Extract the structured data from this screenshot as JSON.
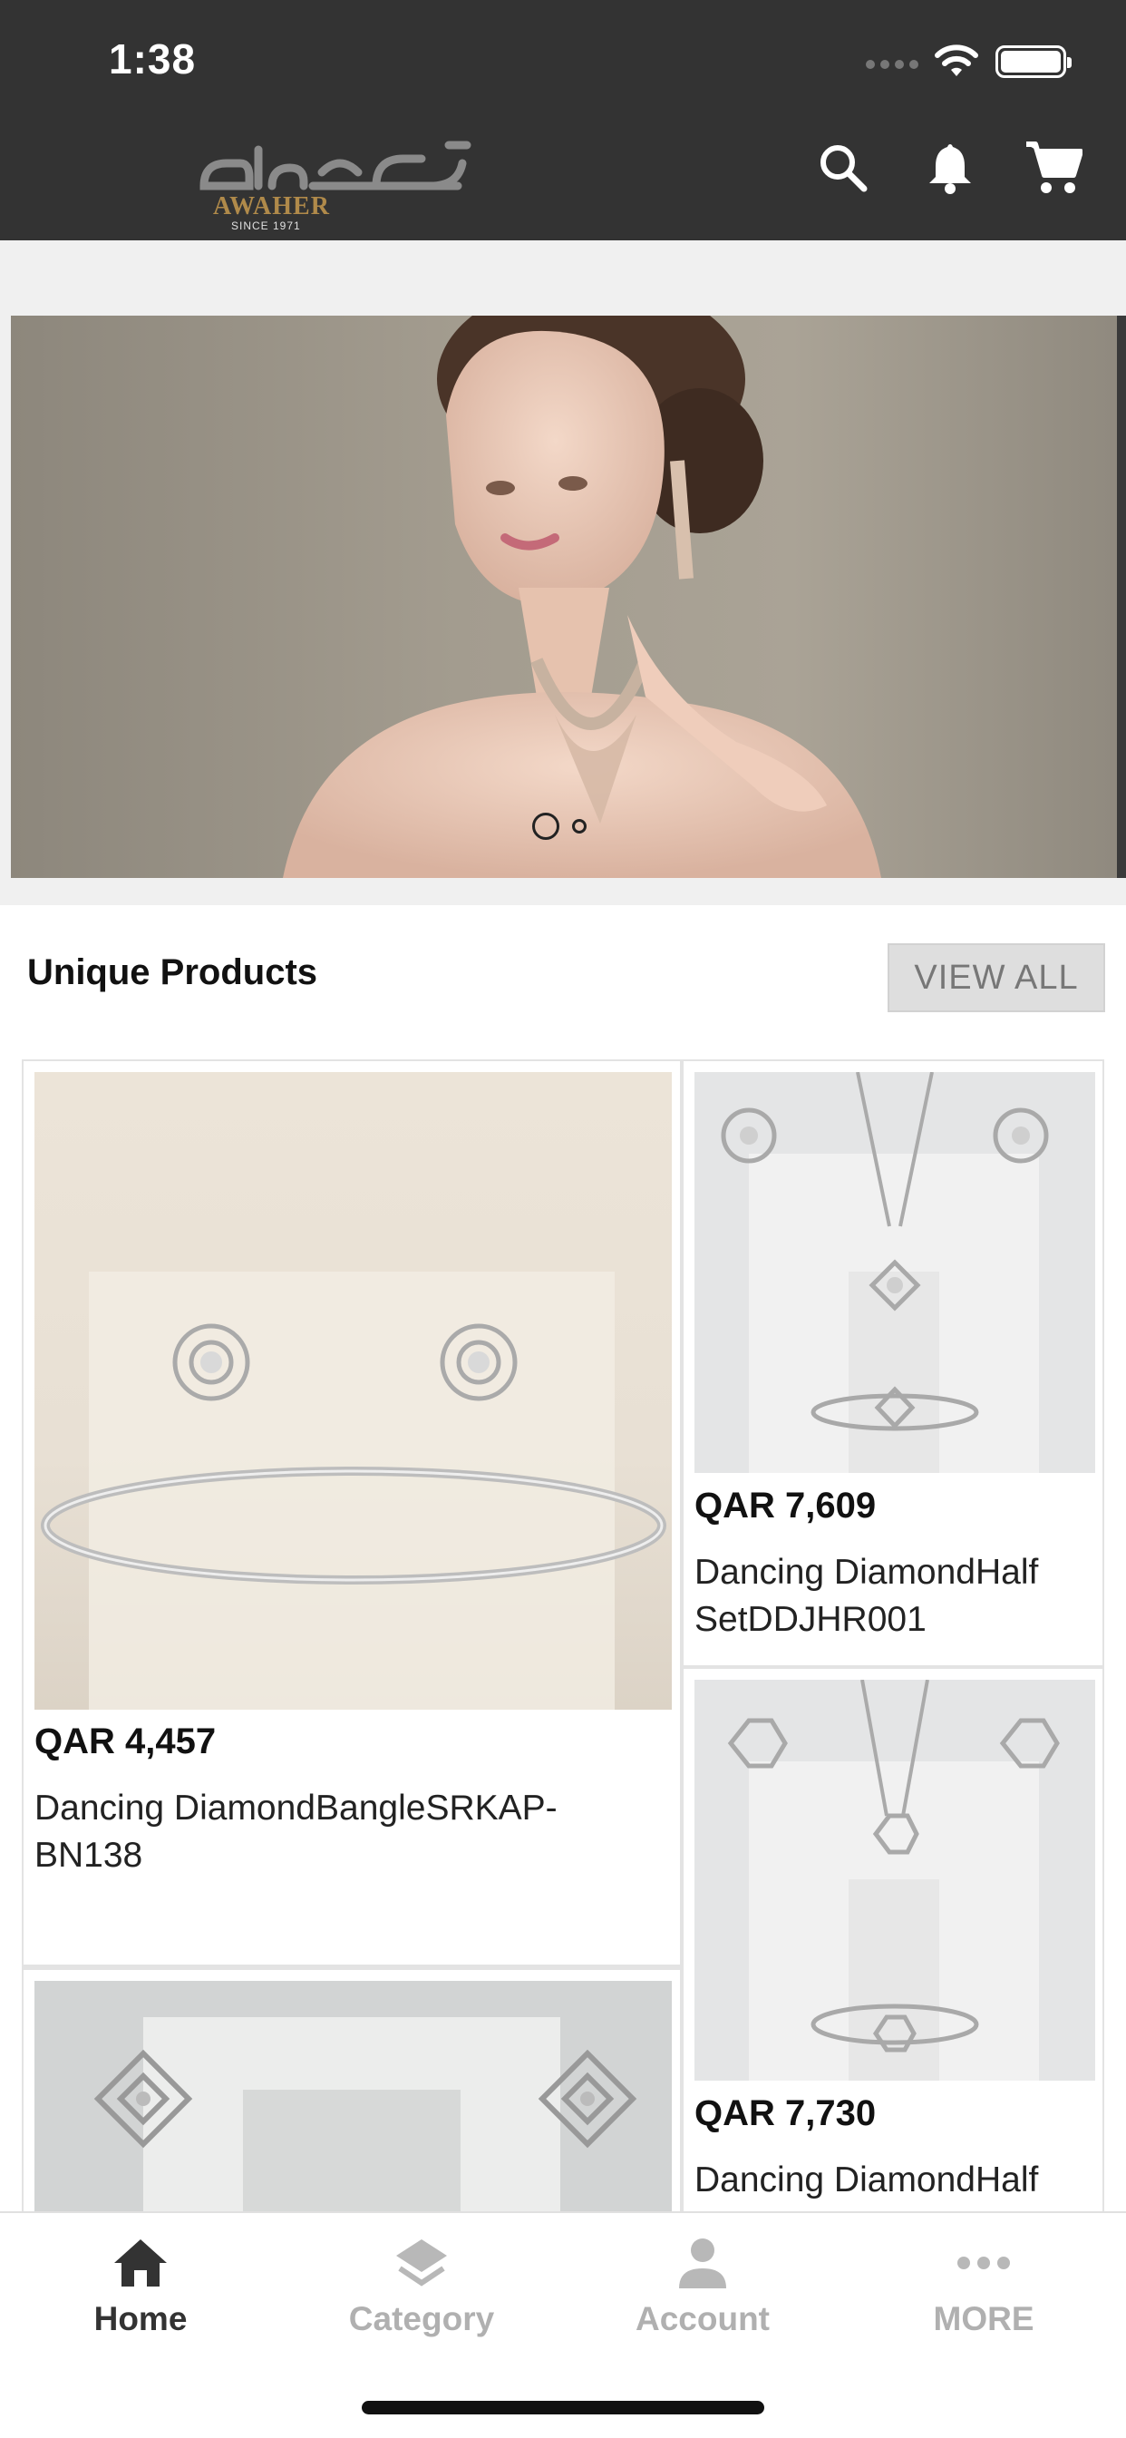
{
  "status_bar": {
    "time": "1:38"
  },
  "header": {
    "logo_text_en": "AWAHER",
    "logo_since": "SINCE 1971",
    "icons": [
      "search-icon",
      "bell-icon",
      "cart-icon"
    ]
  },
  "banner": {
    "slides": 2,
    "active_slide": 1
  },
  "section": {
    "title": "Unique Products",
    "view_all": "VIEW ALL"
  },
  "products": [
    {
      "price": "QAR 4,457",
      "name": "Dancing DiamondBangleSRKAP-BN138"
    },
    {
      "price": "QAR 7,609",
      "name": "Dancing DiamondHalf SetDDJHR001"
    },
    {
      "price": "QAR 7,730",
      "name": "Dancing DiamondHalf"
    }
  ],
  "bottom_nav": [
    {
      "label": "Home",
      "icon": "home-icon",
      "active": true
    },
    {
      "label": "Category",
      "icon": "layers-icon",
      "active": false
    },
    {
      "label": "Account",
      "icon": "person-icon",
      "active": false
    },
    {
      "label": "MORE",
      "icon": "more-dots-icon",
      "active": false
    }
  ],
  "colors": {
    "header_bg": "#333333",
    "gold": "#b08a4a",
    "inactive": "#b0b0b0",
    "active": "#333333"
  }
}
